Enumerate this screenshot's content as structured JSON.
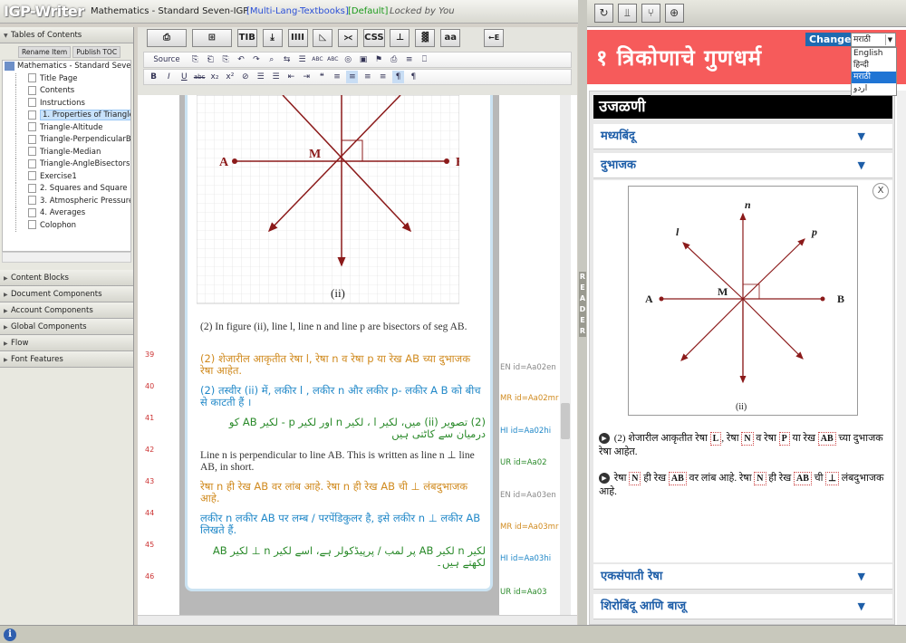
{
  "app": {
    "logo": "IGP-Writer",
    "doc_title": "Mathematics - Standard Seven-IGP",
    "lang_tag": "[Multi-Lang-Textbooks]",
    "default_tag": "[Default]",
    "lock_status": "Locked by You"
  },
  "left": {
    "toc_header": "Tables of Contents",
    "rename_btn": "Rename Item",
    "publish_btn": "Publish TOC",
    "tree": [
      "Mathematics - Standard Seve",
      "Title Page",
      "Contents",
      "Instructions",
      "1. Properties of Triangles",
      "Triangle-Altitude",
      "Triangle-PerpendicularBis",
      "Triangle-Median",
      "Triangle-AngleBisectors",
      "Exercise1",
      "2. Squares and Square Ro",
      "3. Atmospheric Pressure",
      "4. Averages",
      "Colophon"
    ],
    "panels": [
      "Content Blocks",
      "Document Components",
      "Account Components",
      "Global Components",
      "Flow",
      "Font Features"
    ]
  },
  "toolbar": {
    "big": [
      "⎙",
      "⊞",
      "TIB",
      "⤓",
      "IIII",
      "◺",
      "⪥",
      "CSS",
      "⊥",
      "▓",
      "aa",
      "←E"
    ],
    "source": "Source",
    "row2": [
      "⎘",
      "⎗",
      "⎘",
      "↶",
      "↷",
      "⌕",
      "⇆",
      "☰",
      "ABC",
      "ABC",
      "◎",
      "▣",
      "⚑",
      "⎙",
      "≡",
      "⎕"
    ],
    "row3": [
      "B",
      "I",
      "U",
      "abc",
      "x₂",
      "x²",
      "⊘",
      "☰",
      "☰",
      "⇤",
      "⇥",
      "❝",
      "≡",
      "≡",
      "≡",
      "≡",
      "¶",
      "¶"
    ]
  },
  "editor": {
    "line_numbers": [
      "39",
      "40",
      "41",
      "42",
      "43",
      "44",
      "45",
      "46"
    ],
    "fig_labels": {
      "A": "A",
      "B": "B",
      "M": "M",
      "caption": "(ii)"
    },
    "lines": [
      {
        "t": "(2) In figure (ii), line l, line n and line p are bisectors of seg AB.",
        "id": "EN id=Aa02en"
      },
      {
        "t": "(2) शेजारील आकृतीत रेषा l, रेषा n व रेषा p या रेख AB च्या दुभाजक रेषा आहेत.",
        "id": "MR id=Aa02mr"
      },
      {
        "t": "(2) तस्वीर (ii) में, लकीर l , लकीर n और लकीर p- लकीर A B को बीच से काटती हैं ।",
        "id": "HI id=Aa02hi"
      },
      {
        "t": "(2) تصویر (ii) میں، لکیر l ، لکیر n اور لکیر p - لکیر AB کو درمیان سے کاٹتی ہیں",
        "id": "UR id=Aa02"
      },
      {
        "t": "Line n is perpendicular to line AB. This is written as line n ⊥ line AB, in short.",
        "id": "EN id=Aa03en"
      },
      {
        "t": "रेषा n ही रेख AB वर लांब आहे. रेषा n ही रेख AB ची ⊥ लंबदुभाजक आहे.",
        "id": "MR id=Aa03mr"
      },
      {
        "t": "लकीर n लकीर AB पर लम्ब / परपेंडिकुलर है, इसे लकीर n ⊥ लकीर AB लिखते हैं.",
        "id": "HI id=Aa03hi"
      },
      {
        "t": "لکیر n لکیر AB پر لمب / پرپیڈکولر ہے، اسے لکیر n ⊥ لکیر AB لکھتے ہیں۔",
        "id": "UR id=Aa03"
      }
    ]
  },
  "reader": {
    "side_label": "READER",
    "tools": [
      "↻",
      "⫫",
      "⑂",
      "⊕"
    ],
    "title": "१ त्रिकोणाचे गुणधर्म",
    "change_btn": "Change",
    "lang_selected": "मराठी",
    "lang_options": [
      "English",
      "हिन्दी",
      "मराठी",
      "اردو"
    ],
    "section": "उजळणी",
    "acc": [
      "मध्यबिंदू",
      "दुभाजक",
      "एकसंपाती रेषा",
      "शिरोबिंदू आणि बाजू"
    ],
    "close": "X",
    "fig": {
      "A": "A",
      "B": "B",
      "M": "M",
      "l": "l",
      "n": "n",
      "p": "p",
      "caption": "(ii)"
    },
    "speak": "▶",
    "t1": {
      "a": "(2) शेजारील आकृतीत रेषा",
      "b": "L",
      "c": ", रेषा",
      "d": "N",
      "e": "व रेषा",
      "f": "P",
      "g": "या रेख",
      "h": "AB",
      "i": "च्या दुभाजक रेषा आहेत."
    },
    "t2": {
      "a": "रेषा",
      "b": "N",
      "c": "ही रेख",
      "d": "AB",
      "e": "वर लांब आहे. रेषा",
      "f": "N",
      "g": "ही रेख",
      "h": "AB",
      "i": "ची",
      "j": "⊥",
      "k": "लंबदुभाजक आहे."
    }
  },
  "colors": {
    "banner": "#f65b5b",
    "accent": "#1e5ea8",
    "line": "#8b1a1a"
  }
}
